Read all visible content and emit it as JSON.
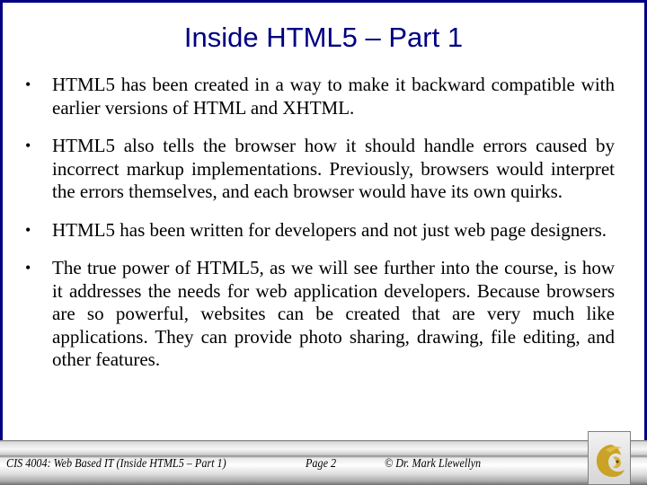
{
  "slide": {
    "title": "Inside HTML5 – Part 1",
    "bullet_glyph": "•",
    "bullets": [
      "HTML5 has been created in a way to make it backward compatible with earlier versions of HTML and XHTML.",
      "HTML5 also tells the browser how it should handle errors caused by incorrect markup implementations.  Previously, browsers would interpret the errors themselves, and each browser would have its own quirks.",
      "HTML5 has been written for developers and not just web page designers.",
      "The true power of HTML5, as we will see further into the course, is how it addresses the needs for web application developers.  Because browsers are so powerful, websites can be created that are very much like applications.  They can provide photo sharing, drawing, file editing, and other features."
    ]
  },
  "footer": {
    "course": "CIS 4004: Web Based IT (Inside HTML5 – Part 1)",
    "page": "Page 2",
    "copyright": "© Dr. Mark Llewellyn",
    "logo": "pegasus-logo"
  },
  "colors": {
    "title": "#000080",
    "border": "#000080",
    "logo_gold": "#c9a227"
  }
}
